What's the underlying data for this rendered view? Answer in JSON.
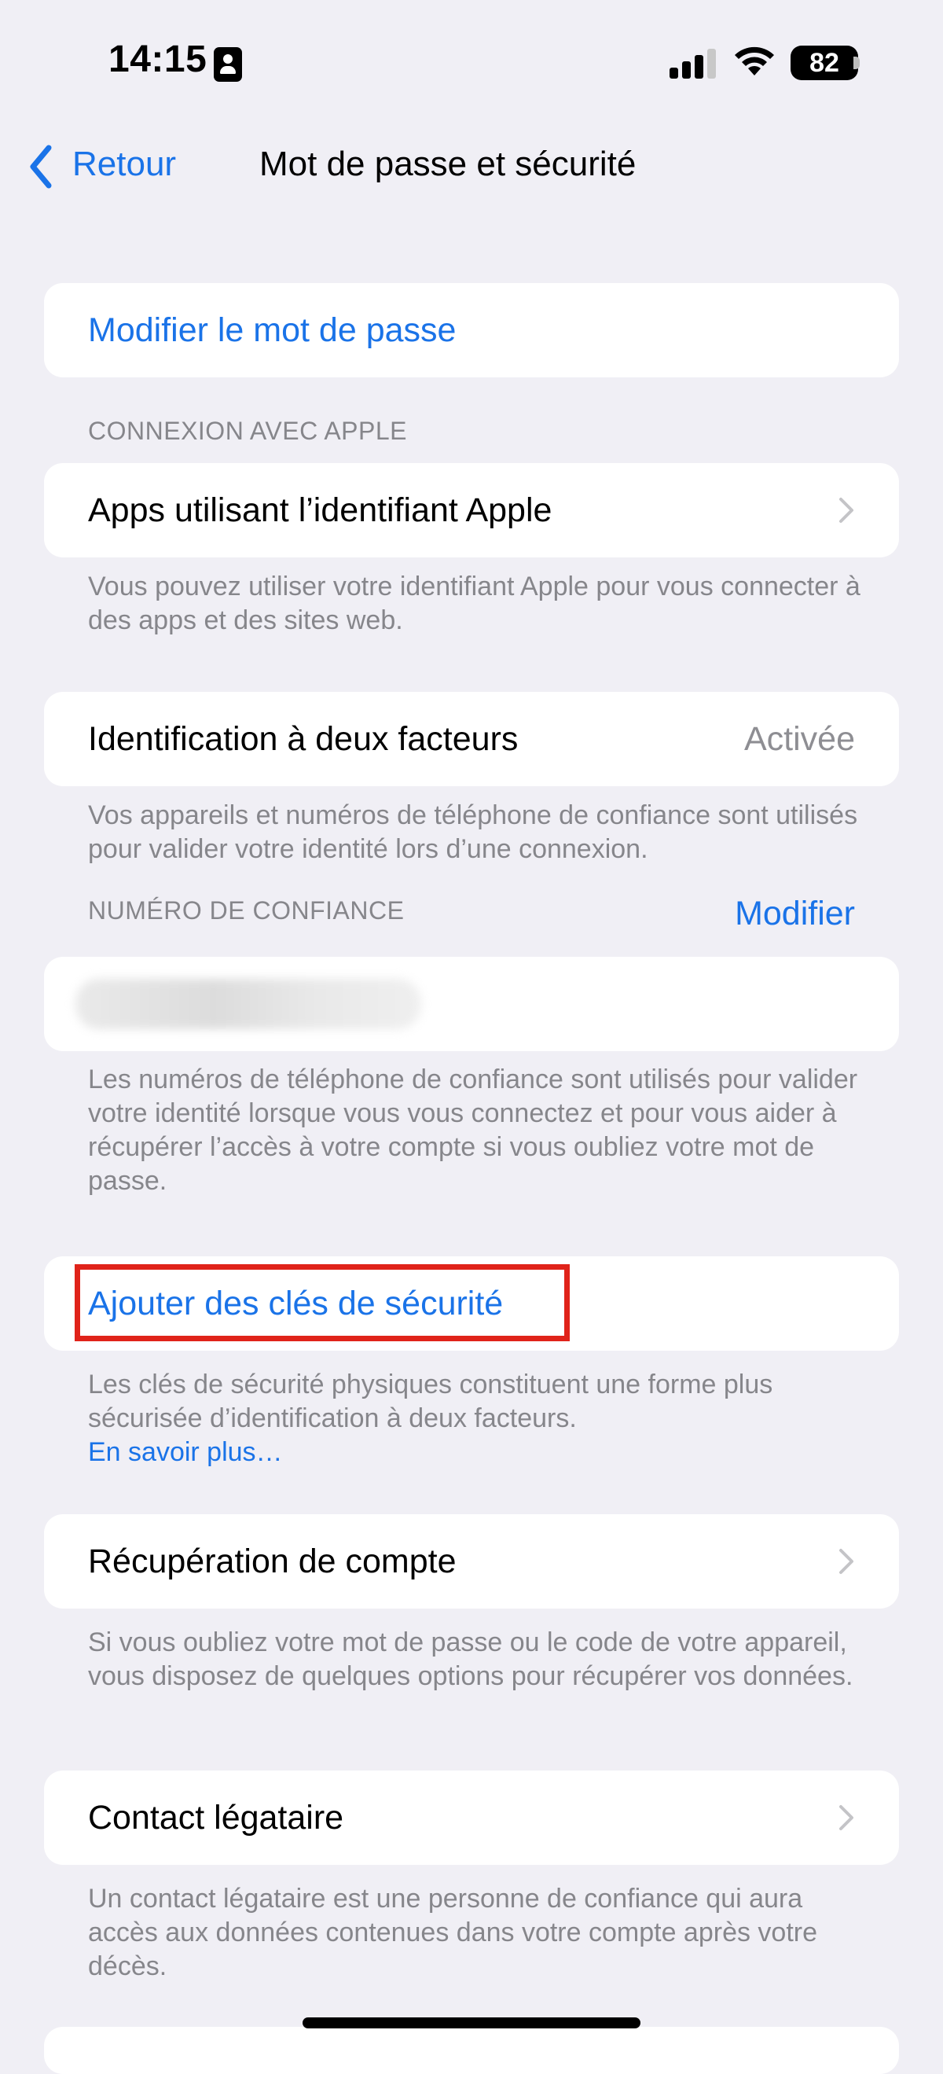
{
  "status_bar": {
    "time": "14:15",
    "battery": "82"
  },
  "nav": {
    "back_label": "Retour",
    "title": "Mot de passe et sécurité"
  },
  "sections": {
    "change_password": {
      "label": "Modifier le mot de passe"
    },
    "sign_in_with_apple": {
      "header": "CONNEXION AVEC APPLE",
      "row_label": "Apps utilisant l’identifiant Apple",
      "footer": "Vous pouvez utiliser votre identifiant Apple pour vous connecter à des apps et des sites web."
    },
    "two_factor": {
      "row_label": "Identification à deux facteurs",
      "row_value": "Activée",
      "footer": "Vos appareils et numéros de téléphone de confiance sont utilisés pour valider votre identité lors d’une connexion."
    },
    "trusted_number": {
      "header": "NUMÉRO DE CONFIANCE",
      "edit_label": "Modifier",
      "footer": "Les numéros de téléphone de confiance sont utilisés pour valider votre identité lorsque vous vous connectez et pour vous aider à récupérer l’accès à votre compte si vous oubliez votre mot de passe."
    },
    "security_keys": {
      "row_label": "Ajouter des clés de sécurité",
      "footer": "Les clés de sécurité physiques constituent une forme plus sécurisée d’identification à deux facteurs.",
      "learn_more": "En savoir plus…"
    },
    "account_recovery": {
      "row_label": "Récupération de compte",
      "footer": "Si vous oubliez votre mot de passe ou le code de votre appareil, vous disposez de quelques options pour récupérer vos données."
    },
    "legacy_contact": {
      "row_label": "Contact légataire",
      "footer": "Un contact légataire est une personne de confiance qui aura accès aux données contenues dans votre compte après votre décès."
    }
  },
  "colors": {
    "accent": "#1a73e8",
    "background": "#f0eff5",
    "highlight": "#e0231a",
    "secondary_text": "#86868b"
  }
}
